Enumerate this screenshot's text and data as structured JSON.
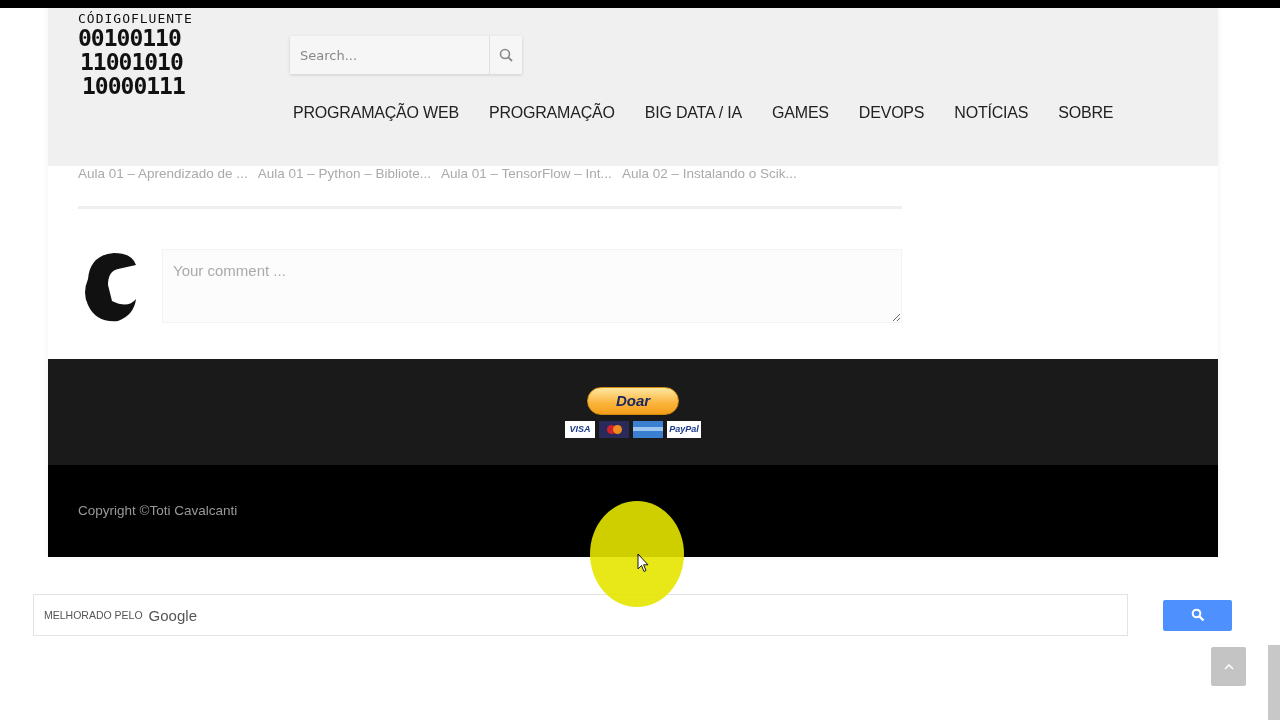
{
  "logo": {
    "title": "CÓDIGOFLUENTE",
    "lines": [
      "00100110",
      "11001010",
      "10000111"
    ]
  },
  "search": {
    "placeholder": "Search..."
  },
  "nav": {
    "items": [
      "PROGRAMAÇÃO WEB",
      "PROGRAMAÇÃO",
      "BIG DATA / IA",
      "GAMES",
      "DEVOPS",
      "NOTÍCIAS",
      "SOBRE"
    ]
  },
  "related_posts": [
    "Aula 01 – Aprendizado de ...",
    "Aula 01 – Python – Bibliote...",
    "Aula 01 – TensorFlow – Int...",
    "Aula 02 – Instalando o Scik..."
  ],
  "comment": {
    "placeholder": "Your comment ..."
  },
  "donate": {
    "label": "Doar",
    "cards": [
      {
        "kind": "visa",
        "label": "VISA"
      },
      {
        "kind": "mastercard"
      },
      {
        "kind": "amex"
      },
      {
        "kind": "paypal",
        "label": "PayPal"
      }
    ]
  },
  "footer": {
    "copyright": "Copyright ©Toti Cavalcanti"
  },
  "google_search": {
    "branding_prefix": "MELHORADO PELO",
    "branding_brand": "Google"
  }
}
